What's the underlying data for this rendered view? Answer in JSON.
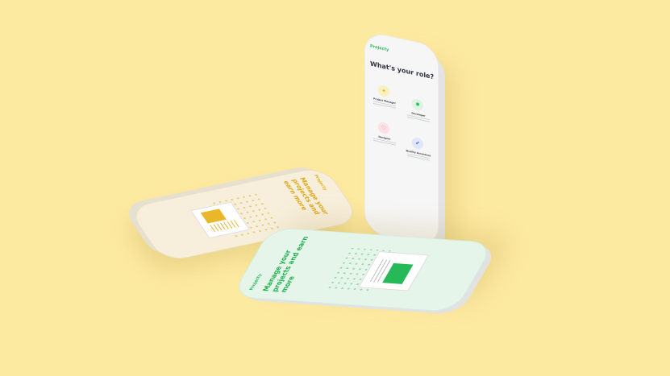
{
  "colors": {
    "background": "#fdeaa1",
    "green_accent": "#2bbd5c",
    "yellow_accent": "#e0a817"
  },
  "phone_right": {
    "app_name": "Projecty",
    "title": "What's your role?",
    "roles": [
      {
        "label": "Project Manager",
        "icon": "lightbulb-icon",
        "color": "#fbf0c0"
      },
      {
        "label": "Developer",
        "icon": "gear-icon",
        "color": "#dff3e3"
      },
      {
        "label": "Designer",
        "icon": "palette-icon",
        "color": "#fbe0e6"
      },
      {
        "label": "Quality Assurance",
        "icon": "check-icon",
        "color": "#e2e6fb"
      }
    ]
  },
  "phone_left": {
    "app_name": "Projecty",
    "headline": "Manage your projects and earn more"
  },
  "phone_bottom": {
    "app_name": "Projecty",
    "headline": "Manage your projects and earn more"
  }
}
